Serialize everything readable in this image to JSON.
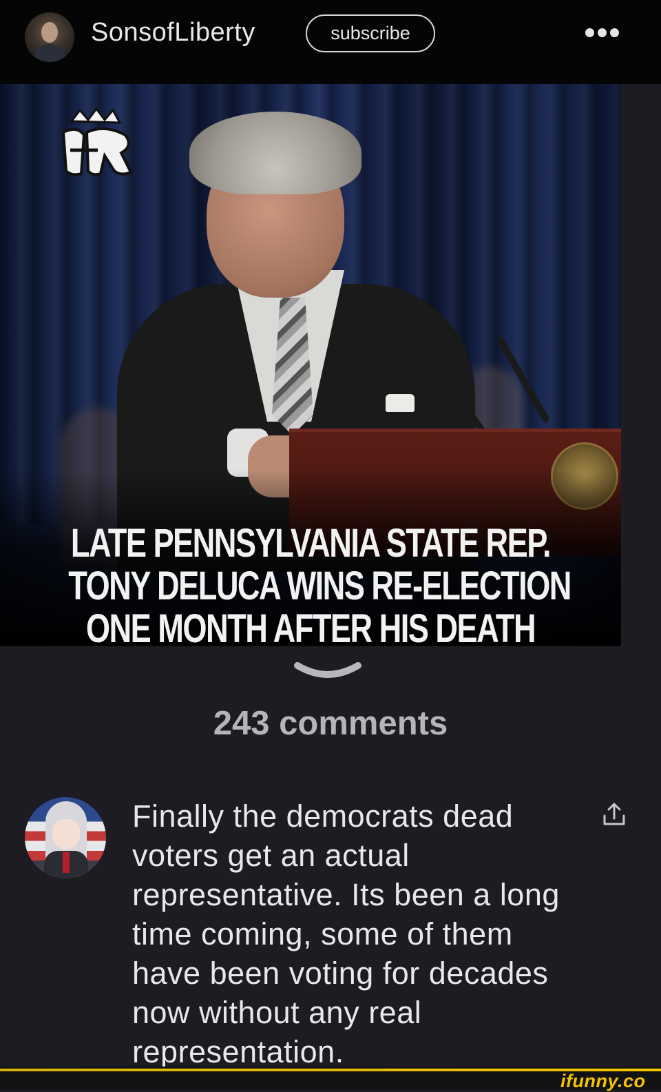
{
  "header": {
    "username": "SonsofLiberty",
    "subscribe_label": "subscribe"
  },
  "post": {
    "caption_lines": [
      "LATE PENNSYLVANIA STATE REP.",
      "TONY DELUCA WINS RE-ELECTION",
      "ONE MONTH AFTER HIS DEATH"
    ]
  },
  "comments": {
    "count_label": "243 comments",
    "items": [
      {
        "text": "Finally the democrats dead voters get an actual representative. Its been a long time coming, some of them have been voting for decades now without any real representation."
      }
    ]
  },
  "watermark": "ifunny.co",
  "colors": {
    "background": "#1c1c22",
    "topbar": "#050505",
    "accent": "#f5c400"
  }
}
